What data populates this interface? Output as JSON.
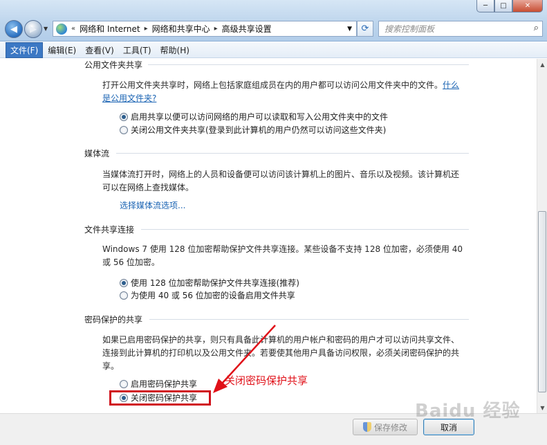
{
  "window": {
    "minimize": "─",
    "maximize": "□",
    "close": "✕"
  },
  "address_bar": {
    "overflow": "«",
    "crumbs": [
      "网络和 Internet",
      "网络和共享中心",
      "高级共享设置"
    ],
    "sep": "▸",
    "drop": "▼"
  },
  "search": {
    "placeholder": "搜索控制面板"
  },
  "menu": {
    "items": [
      "文件(F)",
      "编辑(E)",
      "查看(V)",
      "工具(T)",
      "帮助(H)"
    ]
  },
  "sections": {
    "public_folder": {
      "title": "公用文件夹共享",
      "desc": "打开公用文件夹共享时，网络上包括家庭组成员在内的用户都可以访问公用文件夹中的文件。",
      "link": "什么是公用文件夹?",
      "options": [
        {
          "label": "启用共享以便可以访问网络的用户可以读取和写入公用文件夹中的文件",
          "checked": true
        },
        {
          "label": "关闭公用文件夹共享(登录到此计算机的用户仍然可以访问这些文件夹)",
          "checked": false
        }
      ]
    },
    "media": {
      "title": "媒体流",
      "desc": "当媒体流打开时，网络上的人员和设备便可以访问该计算机上的图片、音乐以及视频。该计算机还可以在网络上查找媒体。",
      "link": "选择媒体流选项..."
    },
    "file_sharing": {
      "title": "文件共享连接",
      "desc": "Windows 7 使用 128 位加密帮助保护文件共享连接。某些设备不支持 128 位加密，必须使用 40 或 56 位加密。",
      "options": [
        {
          "label": "使用 128 位加密帮助保护文件共享连接(推荐)",
          "checked": true
        },
        {
          "label": "为使用 40 或 56 位加密的设备启用文件共享",
          "checked": false
        }
      ]
    },
    "password": {
      "title": "密码保护的共享",
      "desc": "如果已启用密码保护的共享，则只有具备此计算机的用户帐户和密码的用户才可以访问共享文件、连接到此计算机的打印机以及公用文件夹。若要使其他用户具备访问权限，必须关闭密码保护的共享。",
      "options": [
        {
          "label": "启用密码保护共享",
          "checked": false
        },
        {
          "label": "关闭密码保护共享",
          "checked": true
        }
      ]
    }
  },
  "annotation": "关闭密码保护共享",
  "buttons": {
    "save": "保存修改",
    "cancel": "取消"
  },
  "watermark": "Baidu 经验",
  "colors": {
    "accent": "#3c78c4",
    "link": "#1a63b3",
    "annotation": "#e01018"
  }
}
